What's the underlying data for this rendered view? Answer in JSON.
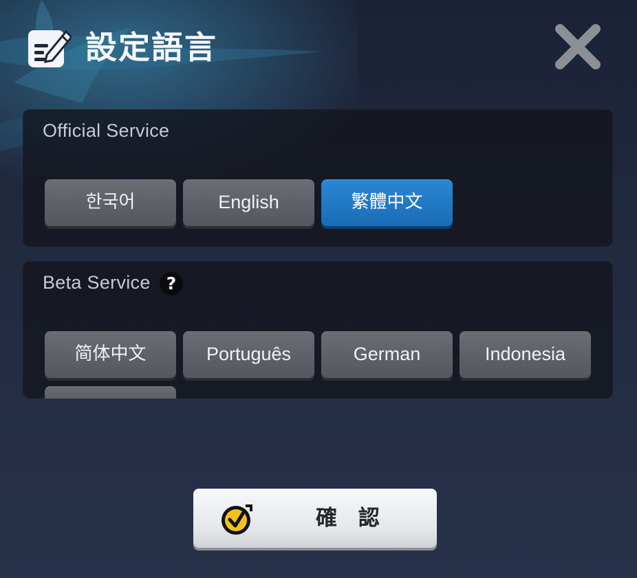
{
  "dialog": {
    "title": "設定語言",
    "title_icon": "edit-settings-icon",
    "close_icon": "close-icon"
  },
  "official": {
    "title": "Official Service",
    "languages": [
      {
        "label": "한국어",
        "selected": false
      },
      {
        "label": "English",
        "selected": false
      },
      {
        "label": "繁體中文",
        "selected": true
      }
    ]
  },
  "beta": {
    "title": "Beta Service",
    "help_icon": "help-icon",
    "help_glyph": "?",
    "languages": [
      {
        "label": "简体中文",
        "selected": false
      },
      {
        "label": "Português",
        "selected": false
      },
      {
        "label": "German",
        "selected": false
      },
      {
        "label": "Indonesia",
        "selected": false
      }
    ]
  },
  "confirm": {
    "label": "確 認",
    "icon": "check-badge-icon"
  },
  "colors": {
    "selected_accent": "#1f7ac7",
    "button_gray": "#5f6168",
    "confirm_icon_yellow": "#f2c21b"
  }
}
